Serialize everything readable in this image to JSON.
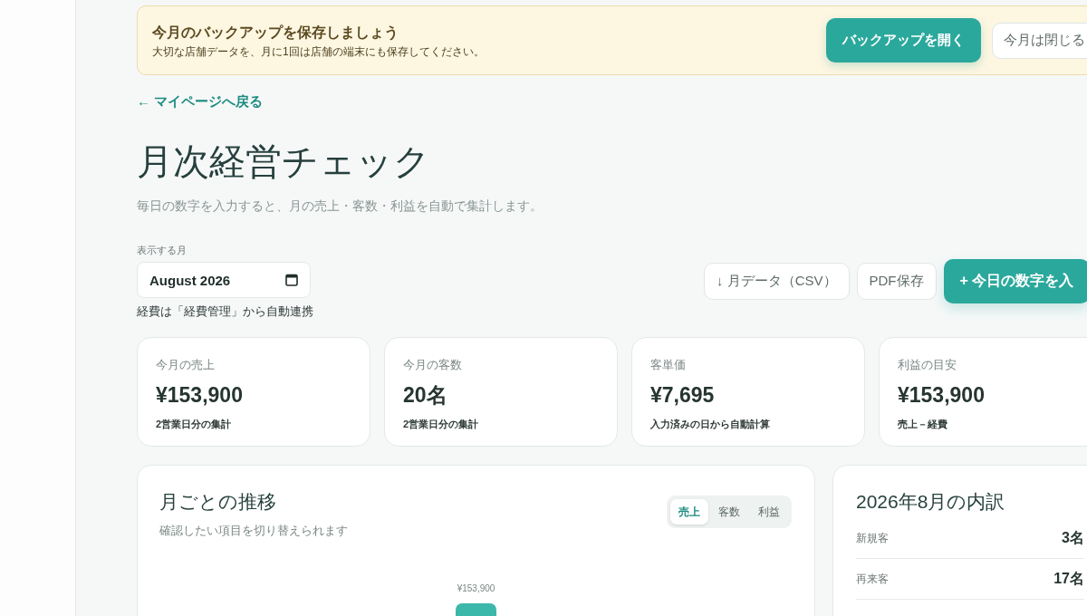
{
  "banner": {
    "title": "今月のバックアップを保存しましょう",
    "message": "大切な店舗データを、月に1回は店舗の端末にも保存してください。",
    "buttons": [
      {
        "label": "バックアップを開く",
        "kind": "primary"
      },
      {
        "label": "今月は閉じる",
        "kind": "secondary"
      }
    ]
  },
  "back_link": "← マイページへ戻る",
  "page": {
    "title": "月次経営チェック",
    "subtitle": "毎日の数字を入力すると、月の売上・客数・利益を自動で集計します。"
  },
  "month_picker": {
    "label": "表示する月",
    "value": "August 2026",
    "note": "経費は「経費管理」から自動連携"
  },
  "actions": [
    {
      "label": "↓ 月データ（CSV）",
      "kind": "outline"
    },
    {
      "label": "PDF保存",
      "kind": "outline"
    },
    {
      "label": "+ 今日の数字を入",
      "kind": "primary"
    }
  ],
  "stats": [
    {
      "label": "今月の売上",
      "value": "¥153,900",
      "note": "2営業日分の集計"
    },
    {
      "label": "今月の客数",
      "value": "20名",
      "note": "2営業日分の集計"
    },
    {
      "label": "客単価",
      "value": "¥7,695",
      "note": "入力済みの日から自動計算"
    },
    {
      "label": "利益の目安",
      "value": "¥153,900",
      "note": "売上－経費"
    }
  ],
  "trend": {
    "title": "月ごとの推移",
    "subtitle": "確認したい項目を切り替えられます",
    "tabs": [
      {
        "label": "売上",
        "selected": true
      },
      {
        "label": "客数",
        "selected": false
      },
      {
        "label": "利益",
        "selected": false
      }
    ],
    "bar_label": "¥153,900"
  },
  "breakdown": {
    "title": "2026年8月の内訳",
    "rows": [
      {
        "label": "新規客",
        "value": "3名"
      },
      {
        "label": "再来客",
        "value": "17名"
      }
    ]
  }
}
